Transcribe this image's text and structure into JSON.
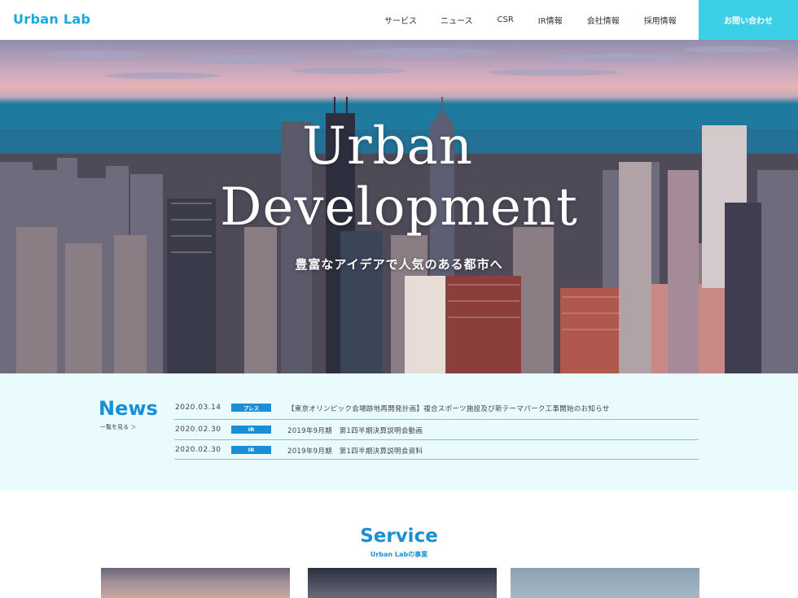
{
  "header": {
    "logo": "Urban Lab",
    "nav": [
      "サービス",
      "ニュース",
      "CSR",
      "IR情報",
      "会社情報",
      "採用情報"
    ],
    "contact": "お問い合わせ"
  },
  "hero": {
    "title_line1": "Urban",
    "title_line2": "Development",
    "subtitle": "豊富なアイデアで人気のある都市へ"
  },
  "news": {
    "title": "News",
    "more": "一覧を見る ＞",
    "items": [
      {
        "date": "2020.03.14",
        "tag": "プレス",
        "text": "【東京オリンピック会場跡地再開発計画】複合スポーツ施設及び新テーマパーク工事開始のお知らせ"
      },
      {
        "date": "2020.02.30",
        "tag": "IR",
        "text": "2019年9月期　第1四半期決算説明会動画"
      },
      {
        "date": "2020.02.30",
        "tag": "IR",
        "text": "2019年9月期　第1四半期決算説明会資料"
      }
    ]
  },
  "service": {
    "title": "Service",
    "subtitle": "Urban Labの事業"
  },
  "colors": {
    "brand": "#1a8fd6",
    "contact_bg": "#3ccfe8",
    "news_bg": "#e9fbfd"
  }
}
